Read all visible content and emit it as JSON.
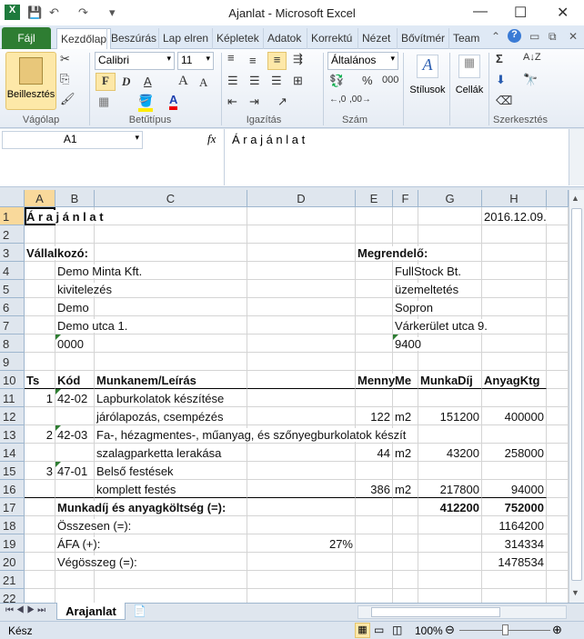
{
  "window": {
    "title": "Ajanlat  -  Microsoft Excel",
    "minimize": "—",
    "maximize": "☐",
    "close": "✕"
  },
  "quick_access": {
    "save": "💾",
    "undo": "↶",
    "redo": "↷",
    "customize": "▾"
  },
  "ribbon_tabs": [
    "Fájl",
    "Kezdőlap",
    "Beszúrás",
    "Lap elren",
    "Képletek",
    "Adatok",
    "Korrektú",
    "Nézet",
    "Bővítmér",
    "Team"
  ],
  "ribbon": {
    "paste_label": "Beillesztés",
    "clipboard_group": "Vágólap",
    "font_name": "Calibri",
    "font_size": "11",
    "bold": "F",
    "italic": "D",
    "underline": "A",
    "grow": "A",
    "shrink": "A",
    "font_group": "Betűtípus",
    "alignment_group": "Igazítás",
    "number_format": "Általános",
    "percent": "%",
    "thousands": "000",
    "number_group": "Szám",
    "styles_label": "Stílusok",
    "cells_label": "Cellák",
    "sum": "Σ",
    "editing_group": "Szerkesztés"
  },
  "formula_bar": {
    "name_box": "A1",
    "fx": "fx",
    "content": "Á r a j á n l a t"
  },
  "columns": [
    "A",
    "B",
    "C",
    "D",
    "E",
    "F",
    "G",
    "H"
  ],
  "rows": [
    {
      "n": "1",
      "cells": {
        "A": {
          "v": "Á r a j á n l a t",
          "b": true
        },
        "H": {
          "v": "2016.12.09."
        }
      }
    },
    {
      "n": "2",
      "cells": {}
    },
    {
      "n": "3",
      "cells": {
        "A": {
          "v": "Vállalkozó:",
          "b": true
        },
        "E": {
          "v": "Megrendelő:",
          "b": true
        }
      }
    },
    {
      "n": "4",
      "cells": {
        "B": {
          "v": "Demo Minta Kft."
        },
        "F": {
          "v": "FullStock Bt."
        }
      }
    },
    {
      "n": "5",
      "cells": {
        "B": {
          "v": "kivitelezés"
        },
        "F": {
          "v": "üzemeltetés"
        }
      }
    },
    {
      "n": "6",
      "cells": {
        "B": {
          "v": "Demo"
        },
        "F": {
          "v": "Sopron"
        }
      }
    },
    {
      "n": "7",
      "cells": {
        "B": {
          "v": "Demo utca 1."
        },
        "F": {
          "v": "Várkerület utca 9."
        }
      }
    },
    {
      "n": "8",
      "cells": {
        "B": {
          "v": "0000",
          "t": true
        },
        "F": {
          "v": "9400",
          "t": true
        }
      }
    },
    {
      "n": "9",
      "cells": {}
    },
    {
      "n": "10",
      "cells": {
        "A": {
          "v": "Ts",
          "b": true
        },
        "B": {
          "v": "Kód",
          "b": true
        },
        "C": {
          "v": "Munkanem/Leírás",
          "b": true
        },
        "E": {
          "v": "Menny",
          "b": true
        },
        "F": {
          "v": "Me",
          "b": true
        },
        "G": {
          "v": "MunkaDíj",
          "b": true
        },
        "H": {
          "v": "AnyagKtg",
          "b": true
        }
      },
      "line": true
    },
    {
      "n": "11",
      "cells": {
        "A": {
          "v": "1",
          "r": true
        },
        "B": {
          "v": "42-02",
          "t": true
        },
        "C": {
          "v": "Lapburkolatok készítése"
        }
      }
    },
    {
      "n": "12",
      "cells": {
        "C": {
          "v": "járólapozás, csempézés"
        },
        "E": {
          "v": "122",
          "r": true
        },
        "F": {
          "v": "m2"
        },
        "G": {
          "v": "151200",
          "r": true
        },
        "H": {
          "v": "400000",
          "r": true
        }
      }
    },
    {
      "n": "13",
      "cells": {
        "A": {
          "v": "2",
          "r": true
        },
        "B": {
          "v": "42-03",
          "t": true
        },
        "C": {
          "v": "Fa-, hézagmentes-, műanyag, és szőnyegburkolatok készít"
        }
      }
    },
    {
      "n": "14",
      "cells": {
        "C": {
          "v": "szalagparketta lerakása"
        },
        "E": {
          "v": "44",
          "r": true
        },
        "F": {
          "v": "m2"
        },
        "G": {
          "v": "43200",
          "r": true
        },
        "H": {
          "v": "258000",
          "r": true
        }
      }
    },
    {
      "n": "15",
      "cells": {
        "A": {
          "v": "3",
          "r": true
        },
        "B": {
          "v": "47-01",
          "t": true
        },
        "C": {
          "v": "Belső festések"
        }
      }
    },
    {
      "n": "16",
      "cells": {
        "C": {
          "v": "komplett festés"
        },
        "E": {
          "v": "386",
          "r": true
        },
        "F": {
          "v": "m2"
        },
        "G": {
          "v": "217800",
          "r": true
        },
        "H": {
          "v": "94000",
          "r": true
        }
      },
      "line": true
    },
    {
      "n": "17",
      "cells": {
        "B": {
          "v": "Munkadíj és anyagköltség (=):",
          "b": true
        },
        "G": {
          "v": "412200",
          "r": true,
          "b": true
        },
        "H": {
          "v": "752000",
          "r": true,
          "b": true
        }
      }
    },
    {
      "n": "18",
      "cells": {
        "B": {
          "v": "Összesen (=):"
        },
        "H": {
          "v": "1164200",
          "r": true
        }
      }
    },
    {
      "n": "19",
      "cells": {
        "B": {
          "v": "ÁFA (+):"
        },
        "D": {
          "v": "27%",
          "r": true
        },
        "H": {
          "v": "314334",
          "r": true
        }
      }
    },
    {
      "n": "20",
      "cells": {
        "B": {
          "v": "Végösszeg (=):"
        },
        "H": {
          "v": "1478534",
          "r": true
        }
      }
    },
    {
      "n": "21",
      "cells": {}
    },
    {
      "n": "22",
      "cells": {}
    }
  ],
  "sheet_tabs": {
    "active": "Arajanlat"
  },
  "status": {
    "ready": "Kész",
    "zoom": "100%"
  }
}
